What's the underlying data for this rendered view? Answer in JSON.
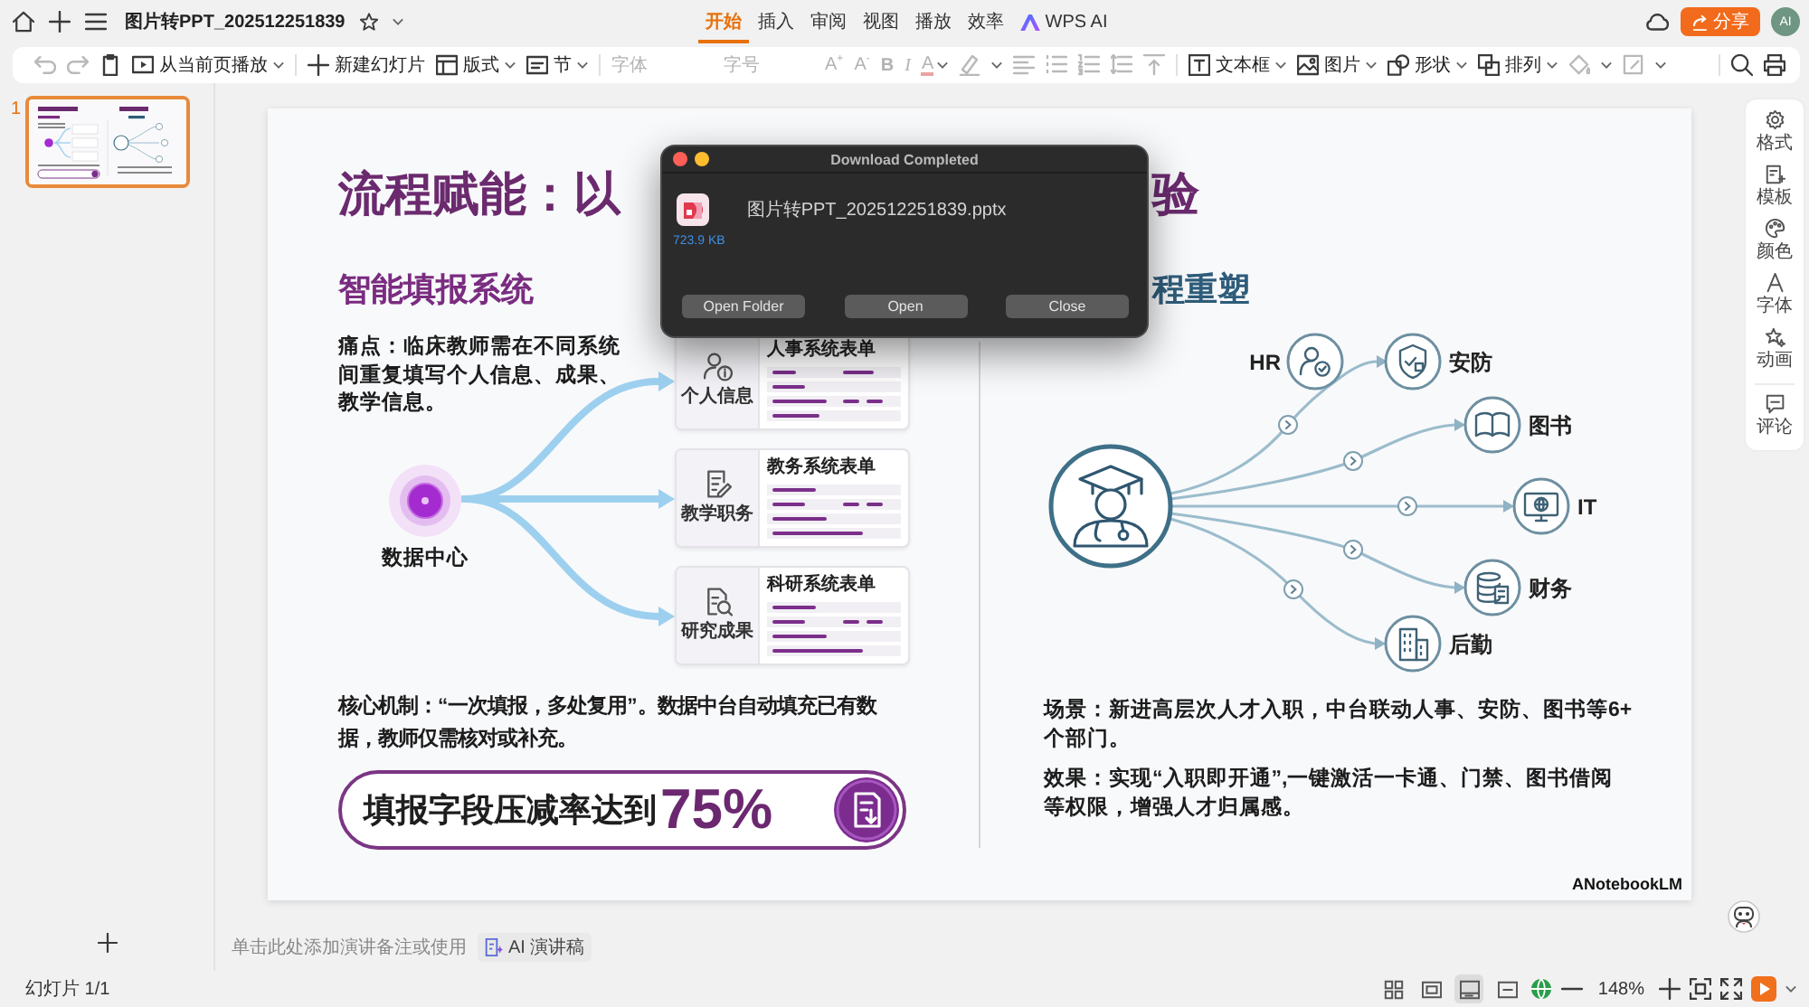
{
  "top_bar": {
    "title": "图片转PPT_202512251839",
    "tabs": [
      {
        "label": "开始",
        "selected": true,
        "kind": "text"
      },
      {
        "label": "插入",
        "selected": false,
        "kind": "text"
      },
      {
        "label": "审阅",
        "selected": false,
        "kind": "text"
      },
      {
        "label": "视图",
        "selected": false,
        "kind": "text"
      },
      {
        "label": "播放",
        "selected": false,
        "kind": "text"
      },
      {
        "label": "效率",
        "selected": false,
        "kind": "text"
      },
      {
        "label": "WPS AI",
        "selected": false,
        "kind": "ai"
      }
    ],
    "share_button": "分享",
    "avatar": "AI"
  },
  "toolbar": {
    "undo": {
      "disabled": true
    },
    "redo": {
      "disabled": true
    },
    "buttons": [
      {
        "label": "从当前页播放"
      },
      {
        "label": "新建幻灯片"
      },
      {
        "label": "版式"
      },
      {
        "label": "节"
      }
    ],
    "font_field": {
      "placeholder": "字体"
    },
    "size_field": {
      "placeholder": "字号"
    },
    "format_buttons": [
      {
        "label": "A$^{+}$",
        "disabled": true
      },
      {
        "label": "A$^{-}$",
        "disabled": true
      },
      {
        "label": "B",
        "disabled": true
      },
      {
        "label": "I",
        "disabled": true
      },
      {
        "label": "A",
        "disabled": true
      }
    ],
    "paragraph_buttons": [
      {
        "disabled": true
      },
      {
        "disabled": true
      },
      {
        "disabled": true
      },
      {
        "disabled": true
      },
      {
        "disabled": true
      },
      {
        "disabled": true
      }
    ],
    "insert_buttons": [
      {
        "label": "文本框"
      },
      {
        "label": "图片"
      },
      {
        "label": "形状"
      },
      {
        "label": "排列"
      }
    ],
    "style_buttons": [
      {
        "disabled": true
      },
      {
        "disabled": true
      }
    ]
  },
  "panel": {
    "thumbnails": [
      {
        "number": "1",
        "selected": true
      }
    ]
  },
  "slide": {
    "title_start": "流程赋能：以",
    "title_end": "验",
    "left": {
      "heading": "智能填报系统",
      "pain_point": "痛点：临床教师需在不同系统间重复填写个人信息、成果、教学信息。",
      "hub_label": "数据中心",
      "forms": [
        {
          "label": "个人信息",
          "title": "人事系统表单"
        },
        {
          "label": "教学职务",
          "title": "教务系统表单"
        },
        {
          "label": "研究成果",
          "title": "科研系统表单"
        }
      ],
      "mechanism": "核心机制：“一次填报，多处复用”。数据中台自动填充已有数据，教师仅需核对或补充。",
      "stat": {
        "text": "填报字段压减率达到",
        "value": "75%"
      }
    },
    "right": {
      "heading_end": "程重塑",
      "nodes": [
        "HR",
        "安防",
        "图书",
        "IT",
        "财务",
        "后勤"
      ],
      "scenario": "场景：新进高层次人才入职，中台联动人事、安防、图书等6+个部门。",
      "effect": "效果：实现“入职即开通”,一键激活一卡通、门禁、图书借阅等权限，增强人才归属感。"
    },
    "brand": "ANotebookLM"
  },
  "dialog": {
    "title": "Download Completed",
    "file_name": "图片转PPT_202512251839.pptx",
    "file_size": "723.9 KB",
    "buttons": [
      "Open Folder",
      "Open",
      "Close"
    ]
  },
  "side_panel": {
    "items": [
      "格式",
      "模板",
      "颜色",
      "字体",
      "动画",
      "评论"
    ]
  },
  "notes": {
    "placeholder": "单击此处添加演讲备注或使用",
    "ai_button": "AI 演讲稿"
  },
  "status_bar": {
    "slide_counter": "幻灯片 1/1",
    "view_modes": [
      {
        "selected": false
      },
      {
        "selected": false
      },
      {
        "selected": true
      },
      {
        "selected": false
      }
    ],
    "zoom": "148%"
  }
}
